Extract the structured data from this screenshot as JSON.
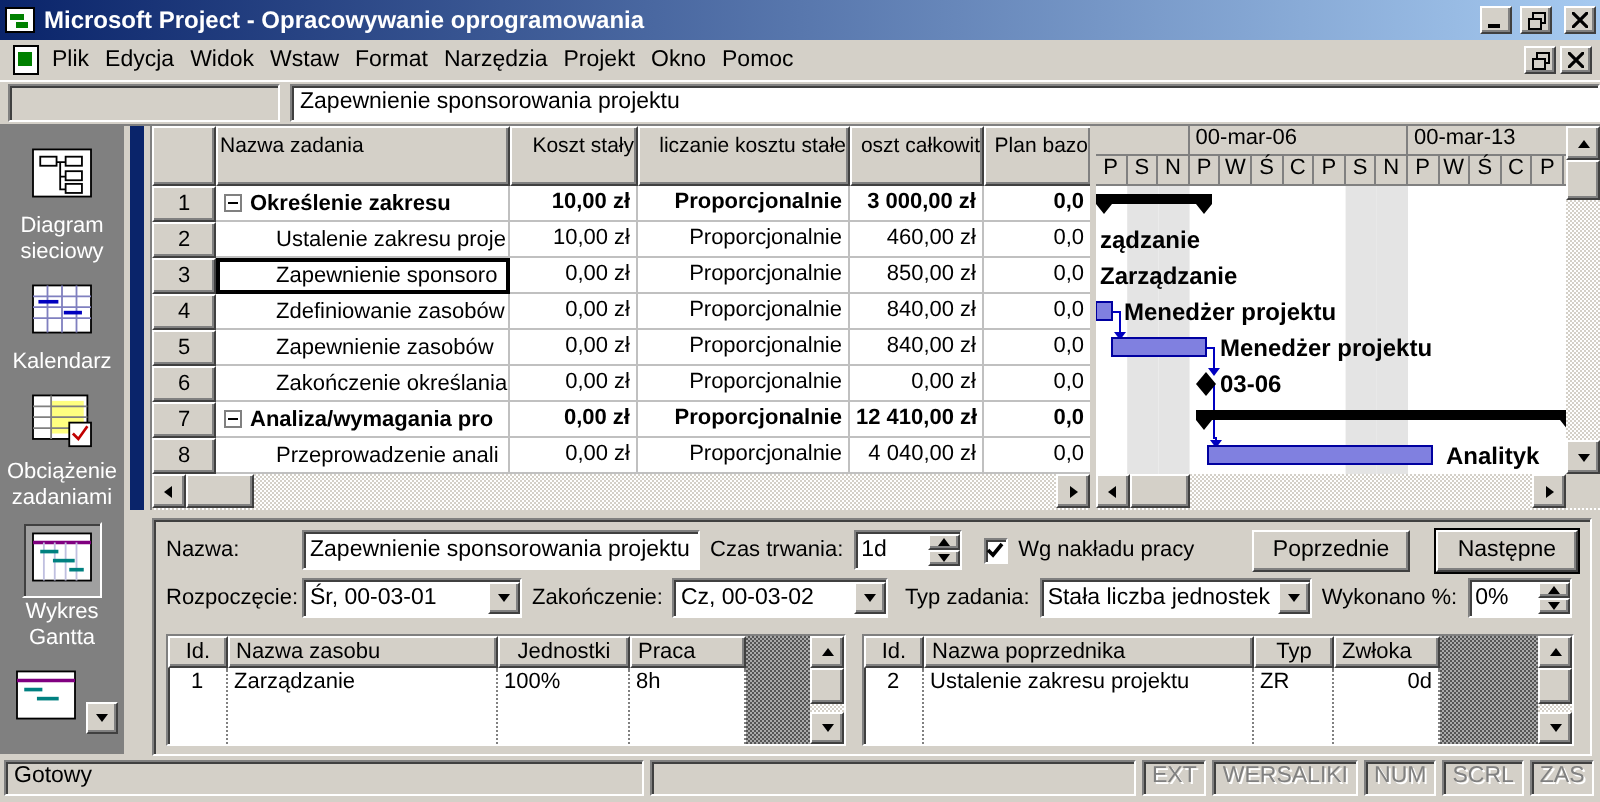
{
  "window": {
    "title": "Microsoft Project - Opracowywanie oprogramowania"
  },
  "menu": [
    "Plik",
    "Edycja",
    "Widok",
    "Wstaw",
    "Format",
    "Narzędzia",
    "Projekt",
    "Okno",
    "Pomoc"
  ],
  "entry_bar": {
    "value": "Zapewnienie sponsorowania projektu"
  },
  "view_bar": [
    {
      "kind": "network",
      "label": "Diagram sieciowy",
      "selected": false
    },
    {
      "kind": "calendar",
      "label": "Kalendarz",
      "selected": false
    },
    {
      "kind": "usage",
      "label": "Obciążenie zadaniami",
      "selected": false
    },
    {
      "kind": "gantt",
      "label": "Wykres Gantta",
      "selected": true
    },
    {
      "kind": "more",
      "selected": false
    }
  ],
  "table": {
    "columns": [
      "Nazwa zadania",
      "Koszt stały",
      "liczanie kosztu stałe",
      "oszt całkowit",
      "Plan bazo"
    ],
    "rows": [
      {
        "id": "1",
        "summary": true,
        "expanded": true,
        "selected": false,
        "cells": [
          "Określenie zakresu",
          "10,00 zł",
          "Proporcjonalnie",
          "3 000,00 zł",
          "0,0"
        ]
      },
      {
        "id": "2",
        "summary": false,
        "selected": false,
        "cells": [
          "Ustalenie zakresu proje",
          "10,00 zł",
          "Proporcjonalnie",
          "460,00 zł",
          "0,0"
        ]
      },
      {
        "id": "3",
        "summary": false,
        "selected": true,
        "cells": [
          "Zapewnienie sponsoro",
          "0,00 zł",
          "Proporcjonalnie",
          "850,00 zł",
          "0,0"
        ]
      },
      {
        "id": "4",
        "summary": false,
        "selected": false,
        "cells": [
          "Zdefiniowanie zasobów",
          "0,00 zł",
          "Proporcjonalnie",
          "840,00 zł",
          "0,0"
        ]
      },
      {
        "id": "5",
        "summary": false,
        "selected": false,
        "cells": [
          "Zapewnienie zasobów",
          "0,00 zł",
          "Proporcjonalnie",
          "840,00 zł",
          "0,0"
        ]
      },
      {
        "id": "6",
        "summary": false,
        "selected": false,
        "cells": [
          "Zakończenie określania",
          "0,00 zł",
          "Proporcjonalnie",
          "0,00 zł",
          "0,0"
        ]
      },
      {
        "id": "7",
        "summary": true,
        "expanded": true,
        "selected": false,
        "cells": [
          "Analiza/wymagania pro",
          "0,00 zł",
          "Proporcjonalnie",
          "12 410,00 zł",
          "0,0"
        ]
      },
      {
        "id": "8",
        "summary": false,
        "selected": false,
        "cells": [
          "Przeprowadzenie anali",
          "0,00 zł",
          "Proporcjonalnie",
          "4 040,00 zł",
          "0,0"
        ]
      }
    ]
  },
  "gantt": {
    "weeks": [
      "00-mar-06",
      "00-mar-13"
    ],
    "days": [
      "P",
      "S",
      "N",
      "P",
      "W",
      "Ś",
      "C",
      "P",
      "S",
      "N",
      "P",
      "W",
      "Ś",
      "C",
      "P"
    ],
    "rows": [
      {
        "kind": "summary"
      },
      {
        "kind": "label",
        "label": "ządzanie"
      },
      {
        "kind": "label",
        "label": "Zarządzanie"
      },
      {
        "kind": "task",
        "label": "Menedżer projektu"
      },
      {
        "kind": "task",
        "label": "Menedżer projektu"
      },
      {
        "kind": "milestone",
        "label": "03-06"
      },
      {
        "kind": "summary"
      },
      {
        "kind": "task",
        "label": "Analityk"
      }
    ]
  },
  "form": {
    "name_label": "Nazwa:",
    "name_value": "Zapewnienie sponsorowania projektu",
    "duration_label": "Czas trwania:",
    "duration_value": "1d",
    "effort_driven": {
      "label": "Wg nakładu pracy",
      "checked": true
    },
    "buttons": [
      {
        "label": "Poprzednie",
        "default": false
      },
      {
        "label": "Następne",
        "default": true
      }
    ],
    "start_label": "Rozpoczęcie:",
    "start_value": "Śr, 00-03-01",
    "finish_label": "Zakończenie:",
    "finish_value": "Cz, 00-03-02",
    "type_label": "Typ zadania:",
    "type_value": "Stała liczba jednostek",
    "complete_label": "Wykonano %:",
    "complete_value": "0%",
    "resources": {
      "columns": [
        "Id.",
        "Nazwa zasobu",
        "Jednostki",
        "Praca"
      ],
      "rows": [
        [
          "1",
          "Zarządzanie",
          "100%",
          "8h"
        ]
      ]
    },
    "predecessors": {
      "columns": [
        "Id.",
        "Nazwa poprzednika",
        "Typ",
        "Zwłoka"
      ],
      "rows": [
        [
          "2",
          "Ustalenie zakresu projektu",
          "ZR",
          "0d"
        ]
      ]
    }
  },
  "status_bar": {
    "text": "Gotowy",
    "indicators": [
      {
        "label": "EXT",
        "on": false
      },
      {
        "label": "WERSALIKI",
        "on": false
      },
      {
        "label": "NUM",
        "on": false
      },
      {
        "label": "SCRL",
        "on": false
      },
      {
        "label": "ZAS",
        "on": false
      }
    ]
  }
}
